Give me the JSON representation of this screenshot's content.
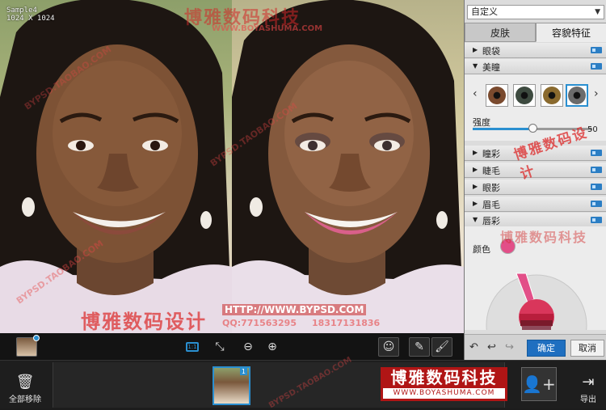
{
  "image_info": {
    "name": "Sample4",
    "size": "1024 X 1024"
  },
  "watermarks": {
    "brand_cn": "博雅数码科技",
    "brand_design": "博雅数码设计",
    "site_url": "WWW.BOYASHUMA.COM",
    "http_url": "HTTP://WWW.BYPSD.COM",
    "qq": "QQ:771563295",
    "phone": "18317131836",
    "taobao": "BYPSD.TAOBAO.COM"
  },
  "panel": {
    "preset_value": "自定义",
    "tabs": [
      {
        "label": "皮肤",
        "active": false
      },
      {
        "label": "容貌特征",
        "active": true
      }
    ],
    "sections": [
      {
        "label": "眼袋",
        "expanded": false
      },
      {
        "label": "美瞳",
        "expanded": true
      },
      {
        "label": "瞳彩",
        "expanded": false
      },
      {
        "label": "睫毛",
        "expanded": false
      },
      {
        "label": "眼影",
        "expanded": false
      },
      {
        "label": "眉毛",
        "expanded": false
      },
      {
        "label": "唇彩",
        "expanded": true
      }
    ],
    "eye_swatches": [
      {
        "color": "#7a4a2e",
        "selected": false
      },
      {
        "color": "#3d4a3f",
        "selected": false
      },
      {
        "color": "#8a6a2e",
        "selected": false
      },
      {
        "color": "#6b6b6b",
        "selected": true
      }
    ],
    "strength": {
      "label": "强度",
      "value": 50,
      "display": "50"
    },
    "lip": {
      "color_label": "颜色",
      "current_color": "#e24f88",
      "wheel_colors": [
        "#b81e3c",
        "#d9365b",
        "#7a1a2b",
        "#8e4a5a"
      ]
    },
    "ok_label": "确定",
    "cancel_label": "取消"
  },
  "bottom": {
    "remove_all_label": "全部移除",
    "export_label": "导出",
    "film_count": "1"
  }
}
